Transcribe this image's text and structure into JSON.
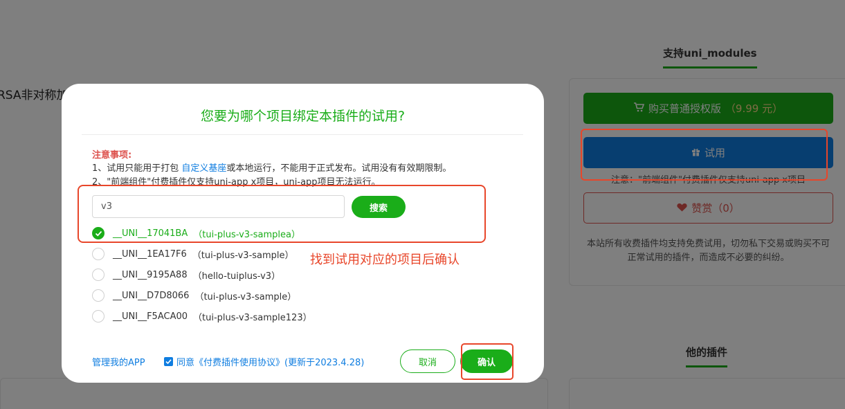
{
  "background": {
    "page_title_fragment": "RSA非对称加",
    "tab_modules": "支持uni_modules",
    "buy_button": {
      "label": "购买普通授权版",
      "price": "（9.99 元）"
    },
    "trial_button": "试用",
    "trial_note": "注意：\"前端组件\"付费插件仅支持uni-app x项目",
    "reward_button": "赞赏（0）",
    "disclaimer": "本站所有收费插件均支持免费试用，切勿私下交易或购买不可正常试用的插件，而造成不必要的纠纷。",
    "tab_his_plugins": "他的插件"
  },
  "modal": {
    "title": "您要为哪个项目绑定本插件的试用?",
    "notice_title": "注意事项:",
    "notice_1_prefix": "1、试用只能用于打包 ",
    "notice_1_link": "自定义基座",
    "notice_1_suffix": "或本地运行，不能用于正式发布。试用没有有效期限制。",
    "notice_2": "2、\"前端组件\"付费插件仅支持uni-app x项目，uni-app项目无法运行。",
    "search": {
      "value": "v3",
      "button_label": "搜索"
    },
    "projects": [
      {
        "id": "__UNI__17041BA",
        "name": "（tui-plus-v3-samplea）",
        "selected": true
      },
      {
        "id": "__UNI__1EA17F6",
        "name": "（tui-plus-v3-sample）",
        "selected": false
      },
      {
        "id": "__UNI__9195A88",
        "name": "（hello-tuiplus-v3）",
        "selected": false
      },
      {
        "id": "__UNI__D7D8066",
        "name": "（tui-plus-v3-sample）",
        "selected": false
      },
      {
        "id": "__UNI__F5ACA00",
        "name": "（tui-plus-v3-sample123）",
        "selected": false
      }
    ],
    "annotation_hint": "找到试用对应的项目后确认",
    "manage_link": "管理我的APP",
    "agreement": "同意《付费插件使用协议》(更新于2023.4.28)",
    "cancel_label": "取消",
    "confirm_label": "确认"
  },
  "colors": {
    "accent_green": "#1aad19",
    "link_blue": "#0f7de0",
    "warn_red": "#dd524d",
    "annotation_red": "#e8462a"
  }
}
